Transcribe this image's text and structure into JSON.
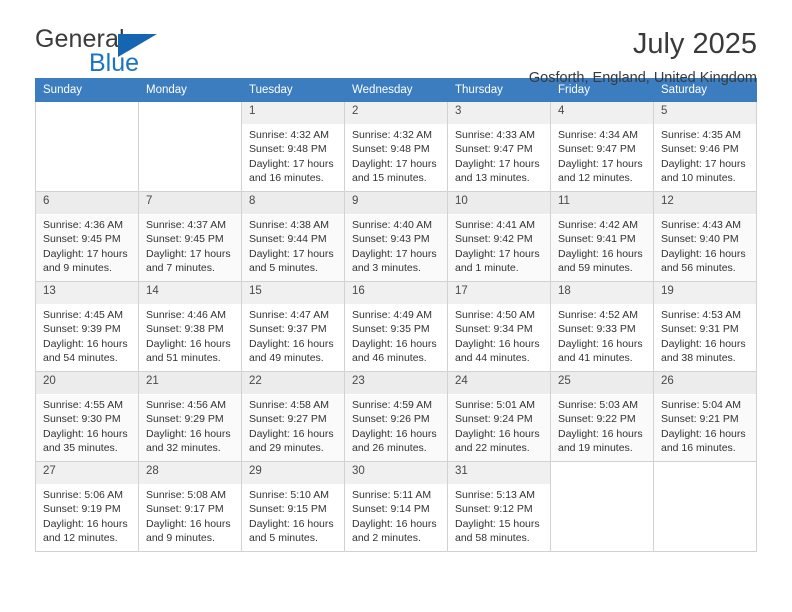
{
  "brand": {
    "name_part1": "General",
    "name_part2": "Blue",
    "accent_color": "#1a73c4",
    "triangle_color": "#1565b0",
    "logo_icon": "triangle-icon"
  },
  "header": {
    "title": "July 2025",
    "subtitle": "Gosforth, England, United Kingdom"
  },
  "calendar": {
    "header_bg": "#3c7dc0",
    "weekdays": [
      "Sunday",
      "Monday",
      "Tuesday",
      "Wednesday",
      "Thursday",
      "Friday",
      "Saturday"
    ],
    "labels": {
      "sunrise": "Sunrise:",
      "sunset": "Sunset:",
      "daylight": "Daylight:"
    },
    "weeks": [
      [
        {
          "day": "",
          "empty": true
        },
        {
          "day": "",
          "empty": true
        },
        {
          "day": "1",
          "sunrise": "Sunrise: 4:32 AM",
          "sunset": "Sunset: 9:48 PM",
          "daylight_line1": "Daylight: 17 hours",
          "daylight_line2": "and 16 minutes."
        },
        {
          "day": "2",
          "sunrise": "Sunrise: 4:32 AM",
          "sunset": "Sunset: 9:48 PM",
          "daylight_line1": "Daylight: 17 hours",
          "daylight_line2": "and 15 minutes."
        },
        {
          "day": "3",
          "sunrise": "Sunrise: 4:33 AM",
          "sunset": "Sunset: 9:47 PM",
          "daylight_line1": "Daylight: 17 hours",
          "daylight_line2": "and 13 minutes."
        },
        {
          "day": "4",
          "sunrise": "Sunrise: 4:34 AM",
          "sunset": "Sunset: 9:47 PM",
          "daylight_line1": "Daylight: 17 hours",
          "daylight_line2": "and 12 minutes."
        },
        {
          "day": "5",
          "sunrise": "Sunrise: 4:35 AM",
          "sunset": "Sunset: 9:46 PM",
          "daylight_line1": "Daylight: 17 hours",
          "daylight_line2": "and 10 minutes."
        }
      ],
      [
        {
          "day": "6",
          "sunrise": "Sunrise: 4:36 AM",
          "sunset": "Sunset: 9:45 PM",
          "daylight_line1": "Daylight: 17 hours",
          "daylight_line2": "and 9 minutes."
        },
        {
          "day": "7",
          "sunrise": "Sunrise: 4:37 AM",
          "sunset": "Sunset: 9:45 PM",
          "daylight_line1": "Daylight: 17 hours",
          "daylight_line2": "and 7 minutes."
        },
        {
          "day": "8",
          "sunrise": "Sunrise: 4:38 AM",
          "sunset": "Sunset: 9:44 PM",
          "daylight_line1": "Daylight: 17 hours",
          "daylight_line2": "and 5 minutes."
        },
        {
          "day": "9",
          "sunrise": "Sunrise: 4:40 AM",
          "sunset": "Sunset: 9:43 PM",
          "daylight_line1": "Daylight: 17 hours",
          "daylight_line2": "and 3 minutes."
        },
        {
          "day": "10",
          "sunrise": "Sunrise: 4:41 AM",
          "sunset": "Sunset: 9:42 PM",
          "daylight_line1": "Daylight: 17 hours",
          "daylight_line2": "and 1 minute."
        },
        {
          "day": "11",
          "sunrise": "Sunrise: 4:42 AM",
          "sunset": "Sunset: 9:41 PM",
          "daylight_line1": "Daylight: 16 hours",
          "daylight_line2": "and 59 minutes."
        },
        {
          "day": "12",
          "sunrise": "Sunrise: 4:43 AM",
          "sunset": "Sunset: 9:40 PM",
          "daylight_line1": "Daylight: 16 hours",
          "daylight_line2": "and 56 minutes."
        }
      ],
      [
        {
          "day": "13",
          "sunrise": "Sunrise: 4:45 AM",
          "sunset": "Sunset: 9:39 PM",
          "daylight_line1": "Daylight: 16 hours",
          "daylight_line2": "and 54 minutes."
        },
        {
          "day": "14",
          "sunrise": "Sunrise: 4:46 AM",
          "sunset": "Sunset: 9:38 PM",
          "daylight_line1": "Daylight: 16 hours",
          "daylight_line2": "and 51 minutes."
        },
        {
          "day": "15",
          "sunrise": "Sunrise: 4:47 AM",
          "sunset": "Sunset: 9:37 PM",
          "daylight_line1": "Daylight: 16 hours",
          "daylight_line2": "and 49 minutes."
        },
        {
          "day": "16",
          "sunrise": "Sunrise: 4:49 AM",
          "sunset": "Sunset: 9:35 PM",
          "daylight_line1": "Daylight: 16 hours",
          "daylight_line2": "and 46 minutes."
        },
        {
          "day": "17",
          "sunrise": "Sunrise: 4:50 AM",
          "sunset": "Sunset: 9:34 PM",
          "daylight_line1": "Daylight: 16 hours",
          "daylight_line2": "and 44 minutes."
        },
        {
          "day": "18",
          "sunrise": "Sunrise: 4:52 AM",
          "sunset": "Sunset: 9:33 PM",
          "daylight_line1": "Daylight: 16 hours",
          "daylight_line2": "and 41 minutes."
        },
        {
          "day": "19",
          "sunrise": "Sunrise: 4:53 AM",
          "sunset": "Sunset: 9:31 PM",
          "daylight_line1": "Daylight: 16 hours",
          "daylight_line2": "and 38 minutes."
        }
      ],
      [
        {
          "day": "20",
          "sunrise": "Sunrise: 4:55 AM",
          "sunset": "Sunset: 9:30 PM",
          "daylight_line1": "Daylight: 16 hours",
          "daylight_line2": "and 35 minutes."
        },
        {
          "day": "21",
          "sunrise": "Sunrise: 4:56 AM",
          "sunset": "Sunset: 9:29 PM",
          "daylight_line1": "Daylight: 16 hours",
          "daylight_line2": "and 32 minutes."
        },
        {
          "day": "22",
          "sunrise": "Sunrise: 4:58 AM",
          "sunset": "Sunset: 9:27 PM",
          "daylight_line1": "Daylight: 16 hours",
          "daylight_line2": "and 29 minutes."
        },
        {
          "day": "23",
          "sunrise": "Sunrise: 4:59 AM",
          "sunset": "Sunset: 9:26 PM",
          "daylight_line1": "Daylight: 16 hours",
          "daylight_line2": "and 26 minutes."
        },
        {
          "day": "24",
          "sunrise": "Sunrise: 5:01 AM",
          "sunset": "Sunset: 9:24 PM",
          "daylight_line1": "Daylight: 16 hours",
          "daylight_line2": "and 22 minutes."
        },
        {
          "day": "25",
          "sunrise": "Sunrise: 5:03 AM",
          "sunset": "Sunset: 9:22 PM",
          "daylight_line1": "Daylight: 16 hours",
          "daylight_line2": "and 19 minutes."
        },
        {
          "day": "26",
          "sunrise": "Sunrise: 5:04 AM",
          "sunset": "Sunset: 9:21 PM",
          "daylight_line1": "Daylight: 16 hours",
          "daylight_line2": "and 16 minutes."
        }
      ],
      [
        {
          "day": "27",
          "sunrise": "Sunrise: 5:06 AM",
          "sunset": "Sunset: 9:19 PM",
          "daylight_line1": "Daylight: 16 hours",
          "daylight_line2": "and 12 minutes."
        },
        {
          "day": "28",
          "sunrise": "Sunrise: 5:08 AM",
          "sunset": "Sunset: 9:17 PM",
          "daylight_line1": "Daylight: 16 hours",
          "daylight_line2": "and 9 minutes."
        },
        {
          "day": "29",
          "sunrise": "Sunrise: 5:10 AM",
          "sunset": "Sunset: 9:15 PM",
          "daylight_line1": "Daylight: 16 hours",
          "daylight_line2": "and 5 minutes."
        },
        {
          "day": "30",
          "sunrise": "Sunrise: 5:11 AM",
          "sunset": "Sunset: 9:14 PM",
          "daylight_line1": "Daylight: 16 hours",
          "daylight_line2": "and 2 minutes."
        },
        {
          "day": "31",
          "sunrise": "Sunrise: 5:13 AM",
          "sunset": "Sunset: 9:12 PM",
          "daylight_line1": "Daylight: 15 hours",
          "daylight_line2": "and 58 minutes."
        },
        {
          "day": "",
          "empty": true
        },
        {
          "day": "",
          "empty": true
        }
      ]
    ]
  }
}
